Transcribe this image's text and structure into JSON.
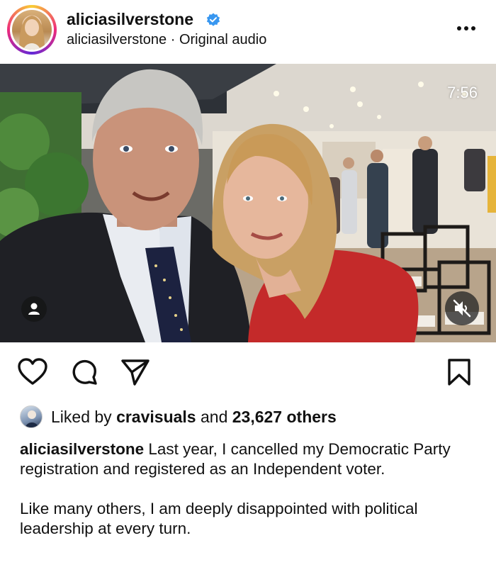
{
  "header": {
    "username": "aliciasilverstone",
    "subline": "aliciasilverstone · Original audio",
    "verified_icon": "verified-badge-icon",
    "more_icon": "more-options-icon"
  },
  "media": {
    "timestamp": "7:56",
    "tag_icon": "person-tag-icon",
    "mute_icon": "muted-speaker-icon"
  },
  "actions": {
    "like_icon": "heart-icon",
    "comment_icon": "comment-icon",
    "share_icon": "send-icon",
    "save_icon": "bookmark-icon"
  },
  "likes": {
    "prefix": "Liked by ",
    "user": "cravisuals",
    "middle": " and ",
    "count": "23,627 others"
  },
  "caption": {
    "username": "aliciasilverstone",
    "line1": " Last year, I cancelled my Democratic Party registration and registered as an Independent voter.",
    "line2": "Like many others, I am deeply disappointed with political leadership at every turn."
  },
  "colors": {
    "verified": "#3897f0",
    "text": "#111111",
    "dress": "#c42a2a"
  }
}
